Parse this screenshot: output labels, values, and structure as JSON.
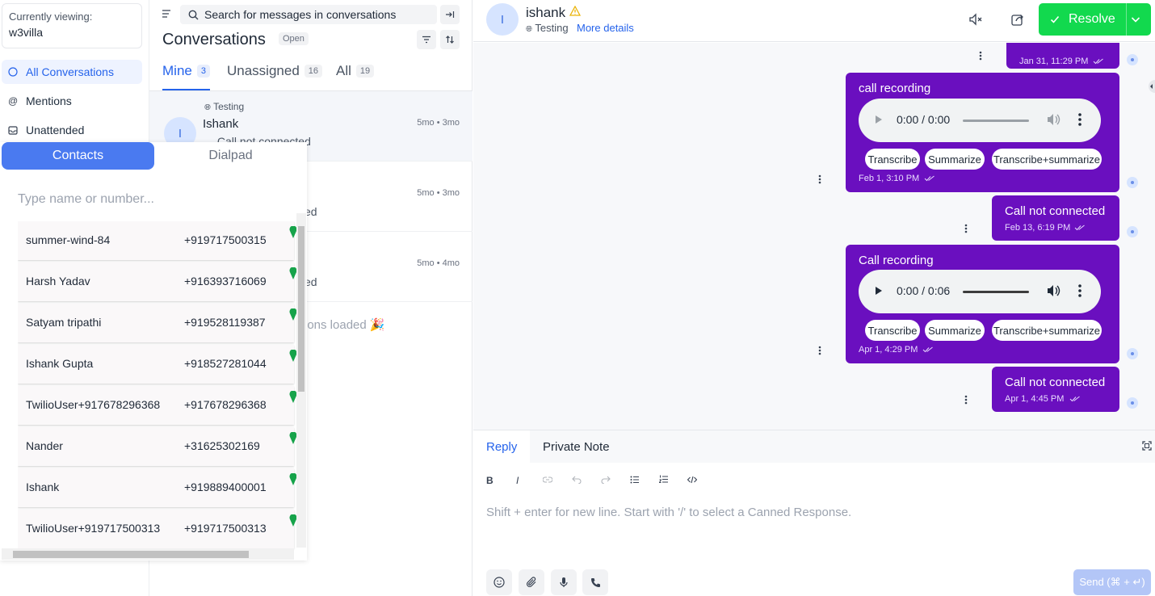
{
  "sidebar": {
    "current_label": "Currently viewing:",
    "current_value": "w3villa",
    "items": [
      {
        "label": "All Conversations"
      },
      {
        "label": "Mentions"
      },
      {
        "label": "Unattended"
      }
    ]
  },
  "conversations": {
    "search_placeholder": "Search for messages in conversations",
    "title": "Conversations",
    "status": "Open",
    "tabs": [
      {
        "label": "Mine",
        "count": "3"
      },
      {
        "label": "Unassigned",
        "count": "16"
      },
      {
        "label": "All",
        "count": "19"
      }
    ],
    "items": [
      {
        "inbox": "Testing",
        "name": "Ishank",
        "avatar": "I",
        "time": "5mo • 3mo",
        "message": "Call not connected"
      },
      {
        "time": "5mo • 3mo",
        "message": "ed"
      },
      {
        "time": "5mo • 4mo",
        "message": "ed"
      }
    ],
    "all_loaded": "ions loaded 🎉"
  },
  "dialer": {
    "tab_contacts": "Contacts",
    "tab_dialpad": "Dialpad",
    "search_placeholder": "Type name or number...",
    "contacts": [
      {
        "name": "summer-wind-84",
        "phone": "+919717500315"
      },
      {
        "name": "Harsh Yadav",
        "phone": "+916393716069"
      },
      {
        "name": "Satyam tripathi",
        "phone": "+919528119387"
      },
      {
        "name": "Ishank Gupta",
        "phone": "+918527281044"
      },
      {
        "name": "TwilioUser+917678296368",
        "phone": "+917678296368"
      },
      {
        "name": "Nander",
        "phone": "+31625302169"
      },
      {
        "name": "Ishank",
        "phone": "+919889400001"
      },
      {
        "name": "TwilioUser+919717500313",
        "phone": "+919717500313"
      }
    ]
  },
  "header": {
    "avatar": "I",
    "name": "ishank",
    "inbox": "Testing",
    "more_details": "More details",
    "resolve_label": "Resolve"
  },
  "messages": [
    {
      "meta": "Jan 31, 11:29 PM"
    },
    {
      "text": "call recording",
      "audio_time": "0:00 / 0:00",
      "actions": [
        "Transcribe",
        "Summarize",
        "Transcribe+summarize"
      ],
      "meta": "Feb 1, 3:10 PM"
    },
    {
      "text": "Call not connected",
      "meta": "Feb 13, 6:19 PM"
    },
    {
      "text": "Call recording",
      "audio_time": "0:00 / 0:06",
      "actions": [
        "Transcribe",
        "Summarize",
        "Transcribe+summarize"
      ],
      "meta": "Apr 1, 4:29 PM"
    },
    {
      "text": "Call not connected",
      "meta": "Apr 1, 4:45 PM"
    }
  ],
  "reply": {
    "tab_reply": "Reply",
    "tab_note": "Private Note",
    "placeholder": "Shift + enter for new line. Start with '/' to select a Canned Response.",
    "send_label": "Send (⌘ + ↵)"
  },
  "colors": {
    "accent": "#2563eb",
    "bubble": "#6a0fbf",
    "resolve": "#12d94e",
    "contacts_tab": "#4a7af0",
    "pin": "#16a34a"
  }
}
